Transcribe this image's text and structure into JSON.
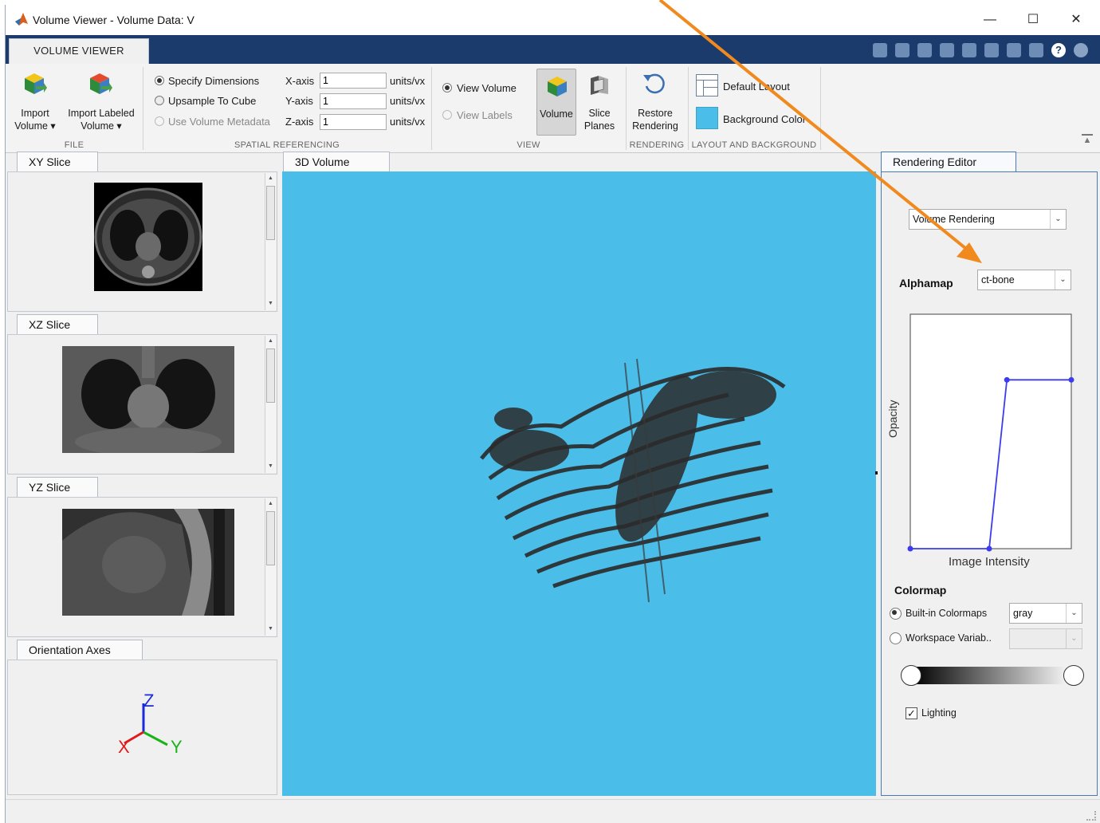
{
  "window": {
    "title": "Volume Viewer - Volume Data: V",
    "minimize": "—",
    "maximize": "☐",
    "close": "✕"
  },
  "toolstrip": {
    "tab": "VOLUME VIEWER",
    "file": {
      "section": "FILE",
      "import_volume": [
        "Import",
        "Volume ▾"
      ],
      "import_labeled": [
        "Import Labeled",
        "Volume ▾"
      ]
    },
    "spatial": {
      "section": "SPATIAL REFERENCING",
      "specify_dimensions": "Specify Dimensions",
      "upsample_to_cube": "Upsample To Cube",
      "use_metadata": "Use Volume Metadata",
      "x_label": "X-axis",
      "x_value": "1",
      "y_label": "Y-axis",
      "y_value": "1",
      "z_label": "Z-axis",
      "z_value": "1",
      "units": "units/vx"
    },
    "view": {
      "section": "VIEW",
      "view_volume": "View Volume",
      "view_labels": "View Labels",
      "volume": "Volume",
      "slice_planes": [
        "Slice",
        "Planes"
      ]
    },
    "rendering": {
      "section": "RENDERING",
      "restore": [
        "Restore",
        "Rendering"
      ]
    },
    "layout": {
      "section": "LAYOUT AND BACKGROUND",
      "default_layout": "Default Layout",
      "background_color": "Background Color"
    }
  },
  "panels": {
    "xy": "XY Slice",
    "xz": "XZ Slice",
    "yz": "YZ Slice",
    "orientation": "Orientation Axes",
    "view3d": "3D Volume",
    "axes": {
      "x": "X",
      "y": "Y",
      "z": "Z"
    }
  },
  "editor": {
    "tab": "Rendering Editor",
    "render_mode": "Volume Rendering",
    "alphamap_label": "Alphamap",
    "alphamap_value": "ct-bone",
    "opacity_label": "Opacity",
    "intensity_label": "Image Intensity",
    "colormap_label": "Colormap",
    "builtin_label": "Built-in Colormaps",
    "builtin_value": "gray",
    "workspace_label": "Workspace Variab..",
    "lighting_label": "Lighting",
    "alphamap_curve": [
      [
        0,
        0
      ],
      [
        0.49,
        0
      ],
      [
        0.6,
        0.72
      ],
      [
        1,
        0.72
      ]
    ]
  },
  "colors": {
    "background": "#4bbde9",
    "annotation_arrow": "#f08a1e",
    "curve": "#3b3bf0"
  }
}
